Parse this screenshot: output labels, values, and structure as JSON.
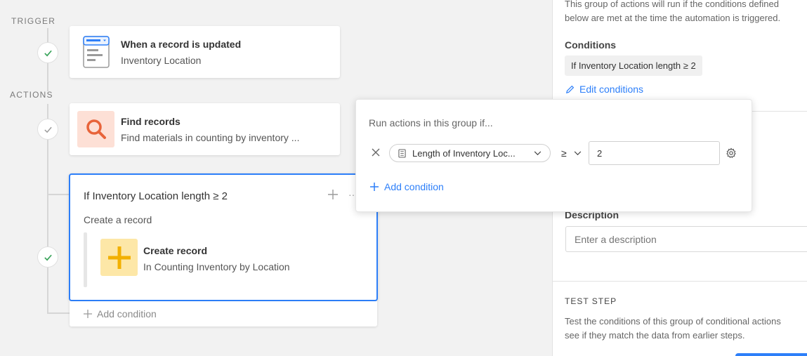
{
  "workflow": {
    "trigger_label": "TRIGGER",
    "actions_label": "ACTIONS",
    "trigger_card": {
      "title": "When a record is updated",
      "subtitle": "Inventory Location"
    },
    "find_card": {
      "title": "Find records",
      "subtitle": "Find materials in counting by inventory ..."
    },
    "group_card": {
      "title": "If Inventory Location length ≥ 2",
      "action_label": "Create a record",
      "nested": {
        "title": "Create record",
        "subtitle": "In Counting Inventory by Location"
      },
      "add_condition": "Add condition"
    }
  },
  "popover": {
    "heading": "Run actions in this group if...",
    "field_label": "Length of Inventory Loc...",
    "operator": "≥",
    "value": "2",
    "add_condition": "Add condition"
  },
  "panel": {
    "intro_line1": "This group of actions will run if the conditions defined",
    "intro_line2": "below are met at the time the automation is triggered.",
    "conditions_label": "Conditions",
    "condition_chip": "If Inventory Location length ≥ 2",
    "edit_conditions": "Edit conditions",
    "description_label": "Description",
    "description_placeholder": "Enter a description",
    "test_step_label": "TEST STEP",
    "test_line1": "Test the conditions of this group of conditional actions",
    "test_line2": "see if they match the data from earlier steps."
  },
  "colors": {
    "accent": "#2d7ff9",
    "search_bg": "#fde0d6",
    "search_icon": "#e8643a",
    "create_bg": "#fde7a7",
    "create_icon": "#f2b000"
  }
}
